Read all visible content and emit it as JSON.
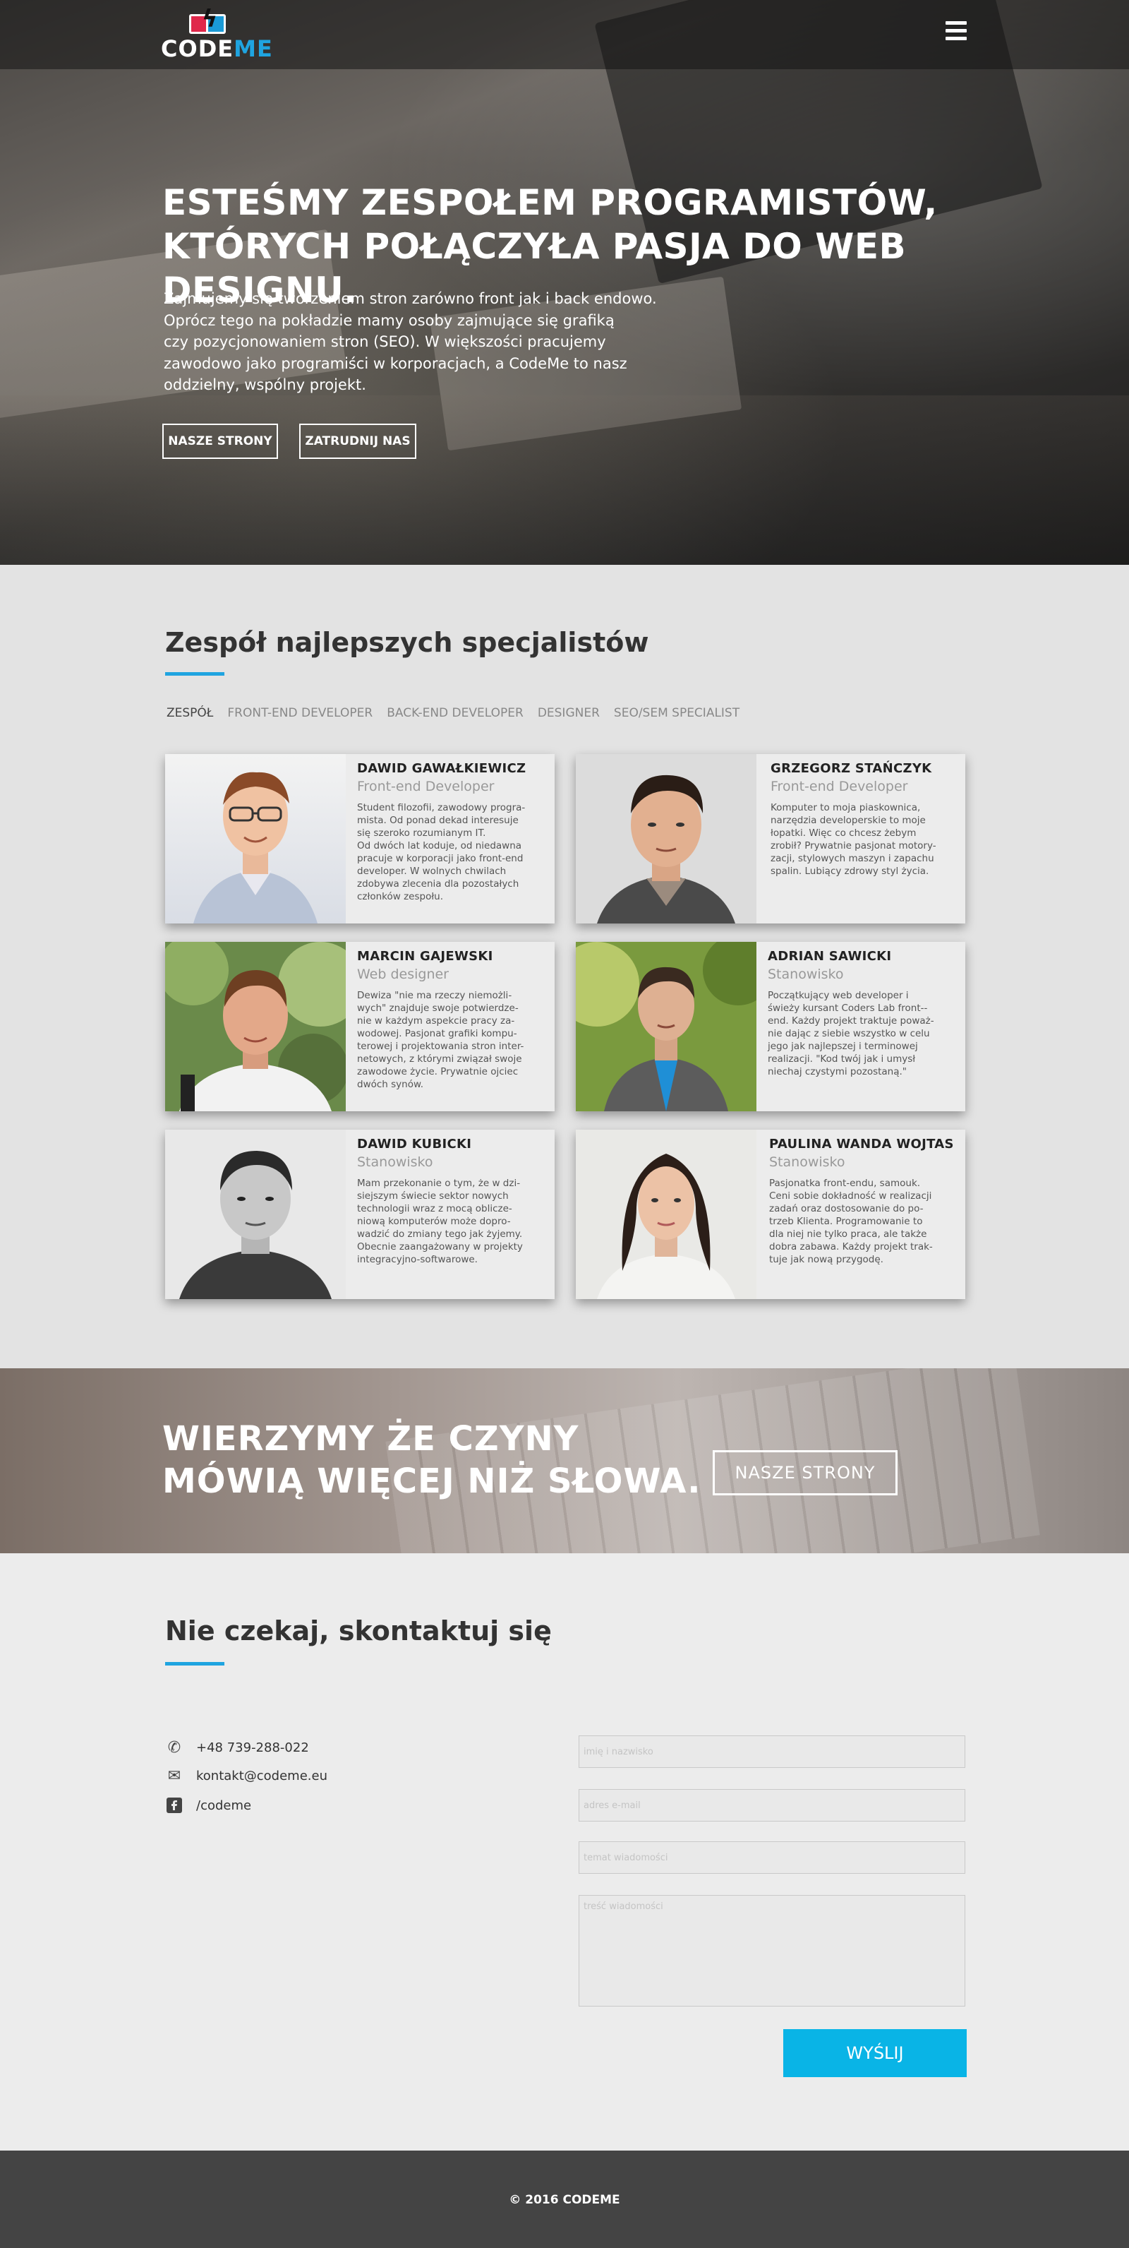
{
  "header": {
    "logo_code": "CODE",
    "logo_me": "ME",
    "menu_icon": "hamburger-menu-icon"
  },
  "hero": {
    "title_line1": "ESTEŚMY ZESPOŁEM PROGRAMISTÓW,",
    "title_line2": "KTÓRYCH POŁĄCZYŁA PASJA DO WEB DESIGNU.",
    "text_lines": [
      "Zajmujemy się tworzeniem stron zarówno front jak i back endowo.",
      "Oprócz tego na pokładzie mamy osoby zajmujące się grafiką",
      "czy pozycjonowaniem stron (SEO). W większości pracujemy",
      "zawodowo jako programiści w korporacjach, a CodeMe to nasz",
      "oddzielny, wspólny projekt."
    ],
    "button_sites": "NASZE STRONY",
    "button_hire": "ZATRUDNIJ NAS"
  },
  "team": {
    "title": "Zespół najlepszych specjalistów",
    "filters": [
      "ZESPÓŁ",
      "FRONT-END DEVELOPER",
      "BACK-END DEVELOPER",
      "DESIGNER",
      "SEO/SEM SPECIALIST"
    ],
    "members": [
      {
        "name": "DAWID GAWAŁKIEWICZ",
        "role": "Front-end Developer",
        "desc": [
          "Student filozofii, zawodowy progra-",
          "mista. Od ponad dekad interesuje",
          "się szeroko rozumianym IT.",
          "Od dwóch lat koduje, od niedawna",
          "pracuje w korporacji jako front-end",
          "developer. W wolnych chwilach",
          "zdobywa zlecenia dla pozostałych",
          "członków zespołu."
        ]
      },
      {
        "name": "GRZEGORZ STAŃCZYK",
        "role": "Front-end Developer",
        "desc": [
          "Komputer to moja piaskownica,",
          "narzędzia developerskie to moje",
          "łopatki. Więc co chcesz żebym",
          "zrobił? Prywatnie pasjonat motory-",
          "zacji, stylowych maszyn i zapachu",
          "spalin. Lubiący zdrowy styl życia."
        ]
      },
      {
        "name": "MARCIN GAJEWSKI",
        "role": "Web designer",
        "desc": [
          "Dewiza \"nie ma rzeczy niemożli-",
          "wych\" znajduje swoje potwierdze-",
          "nie w każdym aspekcie pracy za-",
          "wodowej. Pasjonat grafiki kompu-",
          "terowej i projektowania stron inter-",
          "netowych, z którymi związał swoje",
          "zawodowe życie. Prywatnie ojciec",
          "dwóch synów."
        ]
      },
      {
        "name": "ADRIAN SAWICKI",
        "role": "Stanowisko",
        "desc": [
          "Początkujący web developer i",
          "świeży kursant Coders Lab front--",
          "end. Każdy projekt traktuje poważ-",
          "nie dając z siebie wszystko w celu",
          "jego jak najlepszej i terminowej",
          "realizacji. \"Kod twój jak i umysł",
          "niechaj czystymi pozostaną.\""
        ]
      },
      {
        "name": "DAWID KUBICKI",
        "role": "Stanowisko",
        "desc": [
          "Mam przekonanie o tym, że w dzi-",
          "siejszym świecie sektor nowych",
          "technologii wraz z mocą oblicze-",
          "niową komputerów może dopro-",
          "wadzić do zmiany tego jak żyjemy.",
          "Obecnie zaangażowany w projekty",
          "integracyjno-softwarowe."
        ]
      },
      {
        "name": "PAULINA WANDA WOJTAS",
        "role": "Stanowisko",
        "desc": [
          "Pasjonatka front-endu, samouk.",
          "Ceni sobie dokładność w realizacji",
          "zadań oraz dostosowanie do po-",
          "trzeb Klienta. Programowanie to",
          "dla niej nie tylko praca, ale także",
          "dobra zabawa. Każdy projekt trak-",
          "tuje jak nową przygodę."
        ]
      }
    ]
  },
  "quote": {
    "line1": "WIERZYMY ŻE CZYNY",
    "line2": "MÓWIĄ WIĘCEJ NIŻ SŁOWA.",
    "button": "NASZE STRONY"
  },
  "contact": {
    "title": "Nie czekaj, skontaktuj się",
    "phone": "+48 739-288-022",
    "email": "kontakt@codeme.eu",
    "facebook": "/codeme",
    "form": {
      "name_placeholder": "imię i nazwisko",
      "email_placeholder": "adres e-mail",
      "subject_placeholder": "temat wiadomości",
      "message_placeholder": "treść wiadomości",
      "submit": "WYŚLIJ"
    }
  },
  "footer": {
    "copyright": "© 2016 CODEME"
  },
  "colors": {
    "accent": "#1fa4e0",
    "button_blue": "#09b4e6",
    "footer": "#444444"
  }
}
